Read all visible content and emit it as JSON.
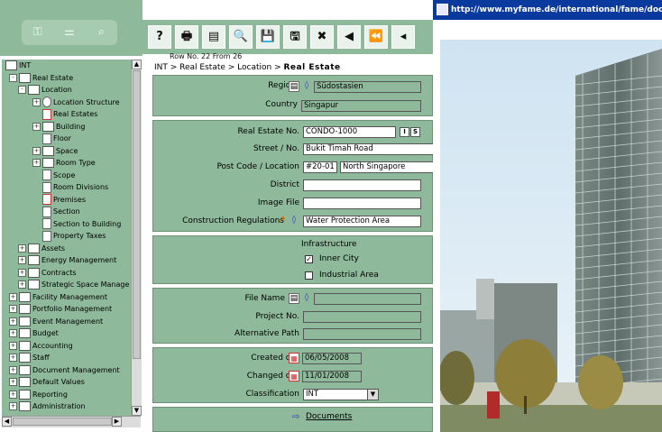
{
  "browser": {
    "url": "http://www.myfame.de/international/fame/doc/bild"
  },
  "tree": {
    "items": [
      {
        "label": "INT",
        "level": 0,
        "kind": "folder",
        "expander": ""
      },
      {
        "label": "Real Estate",
        "level": 1,
        "kind": "folder",
        "expander": "-"
      },
      {
        "label": "Location",
        "level": 2,
        "kind": "folder",
        "expander": "-"
      },
      {
        "label": "Location Structure",
        "level": 3,
        "kind": "gear",
        "expander": "+"
      },
      {
        "label": "Real Estates",
        "level": 3,
        "kind": "doc-red",
        "expander": ""
      },
      {
        "label": "Building",
        "level": 3,
        "kind": "folder",
        "expander": "+"
      },
      {
        "label": "Floor",
        "level": 3,
        "kind": "doc",
        "expander": ""
      },
      {
        "label": "Space",
        "level": 3,
        "kind": "folder",
        "expander": "+"
      },
      {
        "label": "Room Type",
        "level": 3,
        "kind": "folder",
        "expander": "+"
      },
      {
        "label": "Scope",
        "level": 3,
        "kind": "doc",
        "expander": ""
      },
      {
        "label": "Room Divisions",
        "level": 3,
        "kind": "doc",
        "expander": ""
      },
      {
        "label": "Premises",
        "level": 3,
        "kind": "doc-red",
        "expander": ""
      },
      {
        "label": "Section",
        "level": 3,
        "kind": "doc",
        "expander": ""
      },
      {
        "label": "Section to Building",
        "level": 3,
        "kind": "doc",
        "expander": ""
      },
      {
        "label": "Property Taxes",
        "level": 3,
        "kind": "doc",
        "expander": ""
      },
      {
        "label": "Assets",
        "level": 2,
        "kind": "folder",
        "expander": "+"
      },
      {
        "label": "Energy Management",
        "level": 2,
        "kind": "folder",
        "expander": "+"
      },
      {
        "label": "Contracts",
        "level": 2,
        "kind": "folder",
        "expander": "+"
      },
      {
        "label": "Strategic Space Manage",
        "level": 2,
        "kind": "folder",
        "expander": "+"
      },
      {
        "label": "Facility Management",
        "level": 1,
        "kind": "folder",
        "expander": "+"
      },
      {
        "label": "Portfolio Management",
        "level": 1,
        "kind": "folder",
        "expander": "+"
      },
      {
        "label": "Event Management",
        "level": 1,
        "kind": "folder",
        "expander": "+"
      },
      {
        "label": "Budget",
        "level": 1,
        "kind": "folder",
        "expander": "+"
      },
      {
        "label": "Accounting",
        "level": 1,
        "kind": "folder",
        "expander": "+"
      },
      {
        "label": "Staff",
        "level": 1,
        "kind": "folder",
        "expander": "+"
      },
      {
        "label": "Document Management",
        "level": 1,
        "kind": "folder",
        "expander": "+"
      },
      {
        "label": "Default Values",
        "level": 1,
        "kind": "folder",
        "expander": "+"
      },
      {
        "label": "Reporting",
        "level": 1,
        "kind": "folder",
        "expander": "+"
      },
      {
        "label": "Administration",
        "level": 1,
        "kind": "folder",
        "expander": "+"
      }
    ]
  },
  "toolbar": {
    "buttons": [
      {
        "name": "help-button",
        "glyph": "?"
      },
      {
        "name": "print-button",
        "glyph": "🖶"
      },
      {
        "name": "list-button",
        "glyph": "▤"
      },
      {
        "name": "preview-button",
        "glyph": "🔍"
      },
      {
        "name": "save-new-button",
        "glyph": "💾"
      },
      {
        "name": "save-button",
        "glyph": "🖫"
      },
      {
        "name": "delete-button",
        "glyph": "✖"
      },
      {
        "name": "previous-button",
        "glyph": "◀"
      },
      {
        "name": "first-button",
        "glyph": "⏪"
      },
      {
        "name": "back-button",
        "glyph": "◂"
      }
    ]
  },
  "form": {
    "row_info": "Row No. 22 From 26",
    "breadcrumb_prefix": "INT > Real Estate > Location > ",
    "breadcrumb_current": "Real Estate",
    "region_label": "Region",
    "region_value": "Südostasien",
    "country_label": "Country",
    "country_value": "Singapur",
    "real_estate_no_label": "Real Estate No.",
    "real_estate_no_value": "CONDO-1000",
    "btn_i": "I",
    "btn_s": "S",
    "street_label": "Street / No.",
    "street_value": "Bukit Timah Road",
    "postcode_label": "Post Code / Location",
    "postcode_value": "#20-01",
    "location_value": "North Singapore",
    "district_label": "District",
    "district_value": "",
    "image_file_label": "Image File",
    "image_file_value": "",
    "construction_label": "Construction Regulations",
    "construction_value": "Water Protection Area",
    "infrastructure_label": "Infrastructure",
    "inner_city_label": "Inner City",
    "inner_city_checked": "✓",
    "industrial_label": "Industrial Area",
    "industrial_checked": "",
    "file_name_label": "File Name",
    "file_name_value": "",
    "project_no_label": "Project No.",
    "project_no_value": "",
    "alt_path_label": "Alternative Path",
    "alt_path_value": "",
    "created_label": "Created on",
    "created_value": "06/05/2008",
    "changed_label": "Changed on",
    "changed_value": "11/01/2008",
    "classification_label": "Classification",
    "classification_value": "INT",
    "documents_link": "Documents"
  },
  "colors": {
    "panel_green": "#8eb99a",
    "titlebar_blue": "#0a3a9e"
  }
}
